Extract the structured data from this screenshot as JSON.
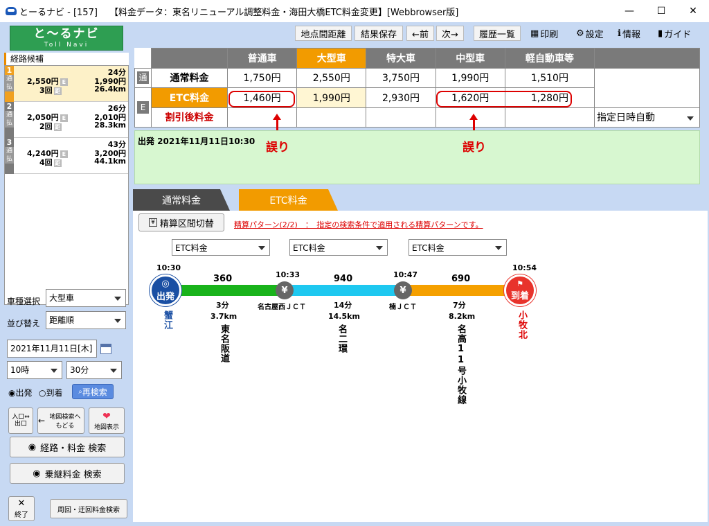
{
  "window": {
    "title": "とーるナビ - [157]　 【料金データ：東名リニューアル調整料金・海田大橋ETC料金変更】[Webbrowser版]",
    "min": "—",
    "max": "☐",
    "close": "✕"
  },
  "logo": {
    "text": "と〜るナビ",
    "sub": "Toll Navi"
  },
  "sidebar": {
    "header": "経路候補",
    "routes": [
      {
        "num": "1",
        "time": "24分",
        "cost1": "2,550円",
        "cost2": "1,990円",
        "count": "3回",
        "dist": "26.4km"
      },
      {
        "num": "2",
        "time": "26分",
        "cost1": "2,050円",
        "cost2": "2,010円",
        "count": "2回",
        "dist": "28.3km"
      },
      {
        "num": "3",
        "time": "43分",
        "cost1": "4,240円",
        "cost2": "3,200円",
        "count": "4回",
        "dist": "44.1km"
      }
    ],
    "side_a": "通",
    "side_b": "払",
    "e_badge": "E",
    "pay_badge": "距",
    "vehicle_label": "車種選択",
    "vehicle_value": "大型車",
    "sort_label": "並び替え",
    "sort_value": "距離順",
    "date_value": "2021年11月11日[木]",
    "hour_value": "10時",
    "minute_value": "30分",
    "radio_depart": "出発",
    "radio_arrive": "到着",
    "research": "再検索",
    "btn_io": "入口⇔出口",
    "btn_back": "地図検索へもどる",
    "btn_map": "地図表示",
    "search_route": "経路・料金 検索",
    "search_transfer": "乗継料金 検索",
    "exit": "終了",
    "loop_search": "周回・迂回料金検索"
  },
  "toolbar": {
    "dist": "地点間距離",
    "save": "結果保存",
    "prev": "←前",
    "next": "次→",
    "history": "履歴一覧",
    "print": "印刷",
    "settings": "設定",
    "info": "情報",
    "guide": "ガイド"
  },
  "fee": {
    "headers": [
      "普通車",
      "大型車",
      "特大車",
      "中型車",
      "軽自動車等"
    ],
    "normal_label": "通常料金",
    "normal": [
      "1,750円",
      "2,550円",
      "3,750円",
      "1,990円",
      "1,510円"
    ],
    "etc_label": "ETC料金",
    "etc": [
      "1,460円",
      "1,990円",
      "2,930円",
      "1,620円",
      "1,280円"
    ],
    "disc_label": "割引後料金",
    "side_normal": "通",
    "side_etc": "E",
    "date_mode": "指定日時自動"
  },
  "errors": {
    "label1": "誤り",
    "label2": "誤り"
  },
  "depart_text": "出発 2021年11月11日10:30",
  "tabs": {
    "normal": "通常料金",
    "etc": "ETC料金"
  },
  "panel": {
    "switch_label": "精算区間切替",
    "pattern_text": "精算パターン(2/2)　：　指定の検索条件で適用される精算パターンです。",
    "dropdowns": [
      "ETC料金",
      "ETC料金",
      "ETC料金"
    ],
    "start_label": "出発",
    "end_label": "到着",
    "times": [
      "10:30",
      "10:33",
      "10:47",
      "10:54"
    ],
    "fares": [
      "360",
      "940",
      "690"
    ],
    "durations": [
      "3分",
      "14分",
      "7分"
    ],
    "distances": [
      "3.7km",
      "14.5km",
      "8.2km"
    ],
    "junctions": [
      "名古屋西ＪＣＴ",
      "楠ＪＣＴ"
    ],
    "start_place": "蟹江",
    "end_place": "小牧北",
    "roads": [
      "東名阪道",
      "名二環",
      "名高11号小牧線"
    ],
    "colors": {
      "seg1": "#19b31b",
      "seg2": "#1ec8f0",
      "seg3": "#f5a000"
    }
  }
}
